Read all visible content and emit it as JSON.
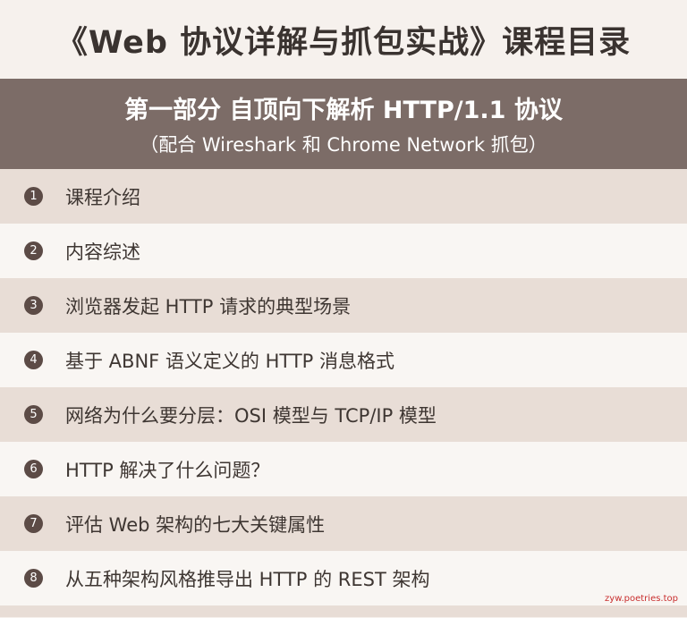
{
  "page": {
    "title": "《Web 协议详解与抓包实战》课程目录"
  },
  "section": {
    "title": "第一部分 自顶向下解析 HTTP/1.1 协议",
    "subtitle": "（配合 Wireshark 和 Chrome Network 抓包）"
  },
  "lessons": [
    {
      "number": "1",
      "label": "课程介绍"
    },
    {
      "number": "2",
      "label": "内容综述"
    },
    {
      "number": "3",
      "label": "浏览器发起 HTTP 请求的典型场景"
    },
    {
      "number": "4",
      "label": "基于 ABNF 语义定义的 HTTP 消息格式"
    },
    {
      "number": "5",
      "label": "网络为什么要分层：OSI 模型与 TCP/IP 模型"
    },
    {
      "number": "6",
      "label": "HTTP 解决了什么问题？"
    },
    {
      "number": "7",
      "label": "评估 Web 架构的七大关键属性"
    },
    {
      "number": "8",
      "label": "从五种架构风格推导出 HTTP 的 REST 架构"
    }
  ],
  "watermark": "zyw.poetries.top",
  "colors": {
    "banner": "#7c6c67",
    "row_shaded": "#e8ddd6",
    "row_plain": "#f9f6f3",
    "badge": "#5c4b46",
    "watermark": "#c92f2f"
  }
}
